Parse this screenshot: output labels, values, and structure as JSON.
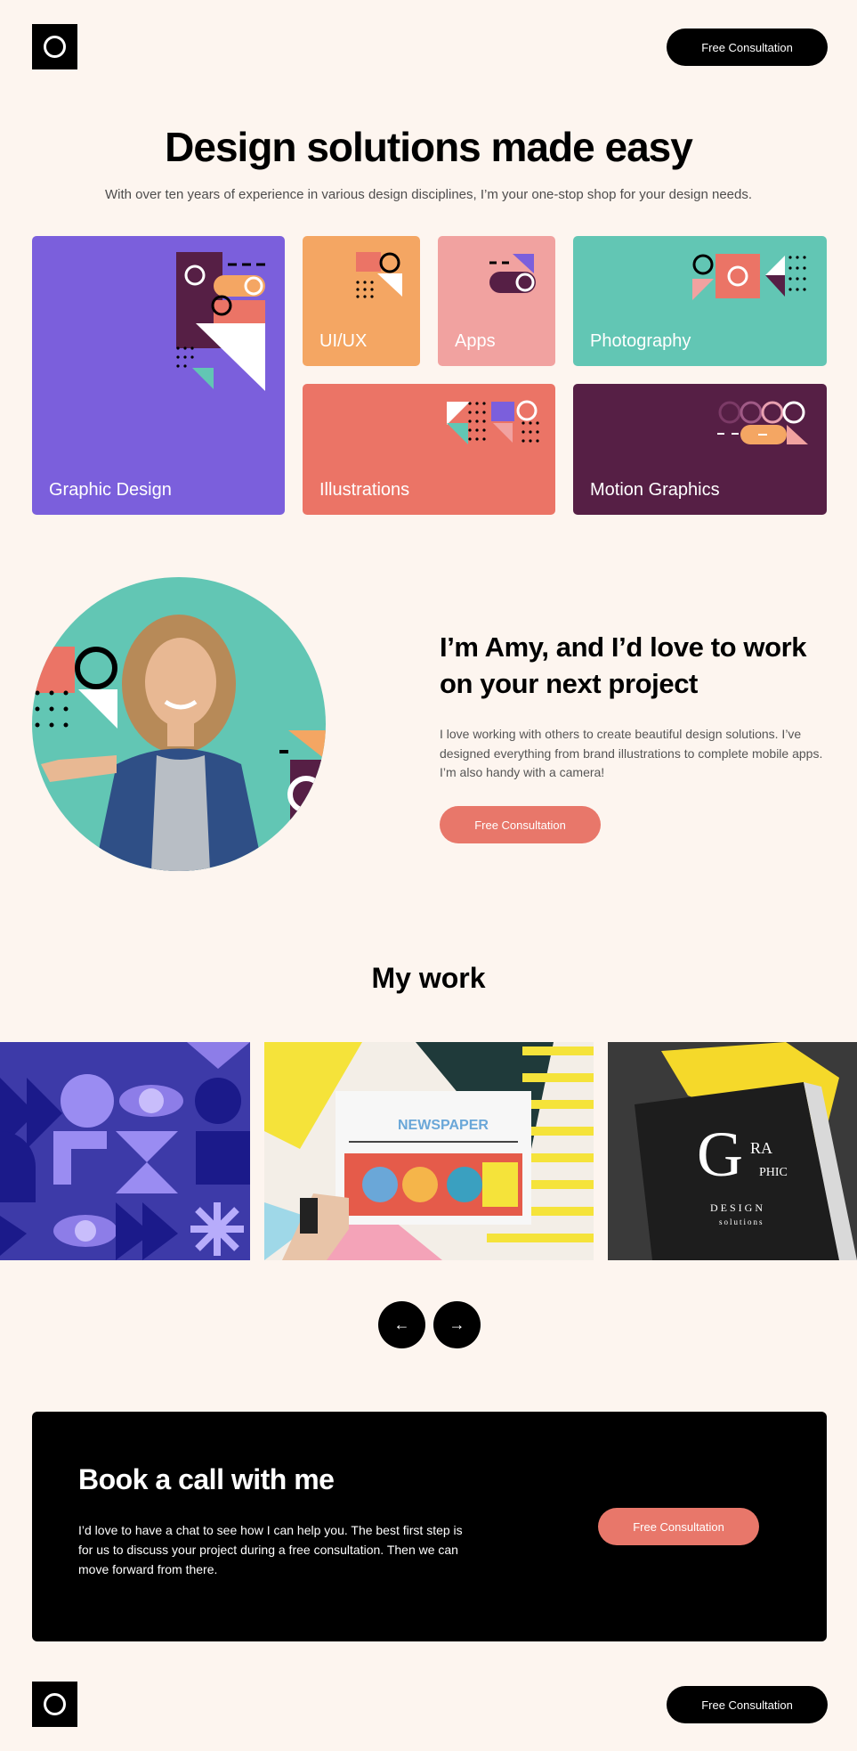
{
  "header": {
    "cta_label": "Free Consultation"
  },
  "hero": {
    "title": "Design solutions made easy",
    "subtitle": "With over ten years of experience in various design disciplines, I’m your one-stop shop for your design needs."
  },
  "services": [
    {
      "label": "Graphic Design",
      "color": "#7b5fdc"
    },
    {
      "label": "UI/UX",
      "color": "#f4a663"
    },
    {
      "label": "Apps",
      "color": "#f1a2a0"
    },
    {
      "label": "Photography",
      "color": "#62c6b4"
    },
    {
      "label": "Illustrations",
      "color": "#eb7466"
    },
    {
      "label": "Motion Graphics",
      "color": "#561f45"
    }
  ],
  "about": {
    "title": "I’m Amy, and I’d love to work on your next project",
    "text": "I love working with others to create beautiful design solutions. I’ve designed everything from brand illustrations to complete mobile apps. I’m also handy with a camera!",
    "cta_label": "Free Consultation"
  },
  "work": {
    "title": "My work",
    "prev_icon": "arrow-left-icon",
    "next_icon": "arrow-right-icon",
    "prev_glyph": "←",
    "next_glyph": "→",
    "newspaper_text": "NEWSPAPER",
    "book_text_g": "G",
    "book_text_ra": "RA",
    "book_text_phic": "PHIC",
    "book_text_design": "DESIGN",
    "book_text_solutions": "solutions"
  },
  "booking": {
    "title": "Book a call with me",
    "text": "I’d love to have a chat to see how I can help you. The best first step is for us to discuss your project during a free consultation. Then we can move forward from there.",
    "cta_label": "Free Consultation"
  },
  "footer": {
    "cta_label": "Free Consultation"
  },
  "colors": {
    "background": "#fdf5ef",
    "accent": "#e8776a",
    "dark": "#000000",
    "teal": "#62c6b4",
    "purple": "#7b5fdc",
    "plum": "#561f45"
  }
}
